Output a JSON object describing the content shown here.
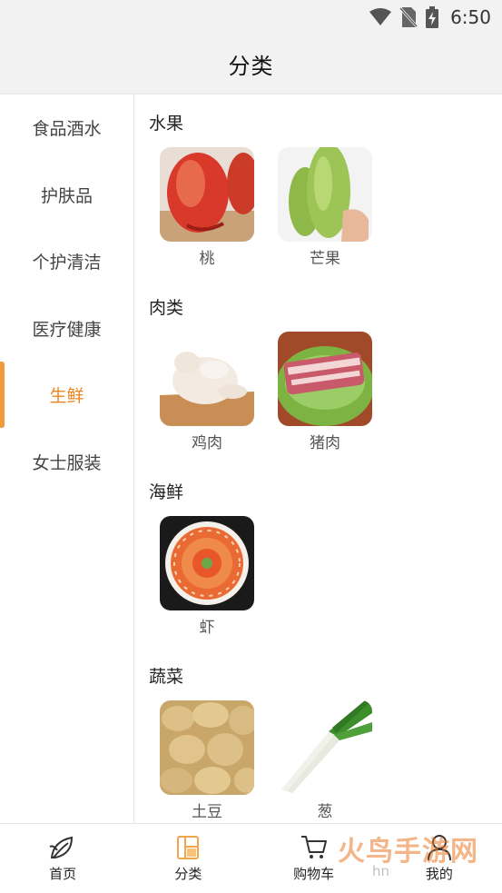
{
  "status_bar": {
    "time": "6:50",
    "icons": [
      "wifi-icon",
      "no-sim-icon",
      "battery-charging-icon"
    ]
  },
  "header": {
    "title": "分类"
  },
  "sidebar": {
    "items": [
      {
        "label": "食品酒水",
        "active": false
      },
      {
        "label": "护肤品",
        "active": false
      },
      {
        "label": "个护清洁",
        "active": false
      },
      {
        "label": "医疗健康",
        "active": false
      },
      {
        "label": "生鲜",
        "active": true
      },
      {
        "label": "女士服装",
        "active": false
      }
    ]
  },
  "content": {
    "sections": [
      {
        "title": "水果",
        "items": [
          {
            "label": "桃",
            "image": "peach-image"
          },
          {
            "label": "芒果",
            "image": "mango-image"
          }
        ]
      },
      {
        "title": "肉类",
        "items": [
          {
            "label": "鸡肉",
            "image": "chicken-image"
          },
          {
            "label": "猪肉",
            "image": "pork-image"
          }
        ]
      },
      {
        "title": "海鲜",
        "items": [
          {
            "label": "虾",
            "image": "shrimp-image"
          }
        ]
      },
      {
        "title": "蔬菜",
        "items": [
          {
            "label": "土豆",
            "image": "potato-image"
          },
          {
            "label": "葱",
            "image": "scallion-image"
          }
        ]
      }
    ]
  },
  "bottom_nav": {
    "items": [
      {
        "label": "首页",
        "icon": "leaf-home-icon",
        "active": false
      },
      {
        "label": "分类",
        "icon": "category-icon",
        "active": true
      },
      {
        "label": "购物车",
        "icon": "cart-icon",
        "active": false
      },
      {
        "label": "我的",
        "icon": "person-icon",
        "active": false
      }
    ]
  },
  "watermark": {
    "text": "火鸟手游网",
    "sub": "hn"
  },
  "colors": {
    "accent": "#f2841f",
    "indicator": "#f39a3a",
    "background": "#f2f2f2"
  }
}
